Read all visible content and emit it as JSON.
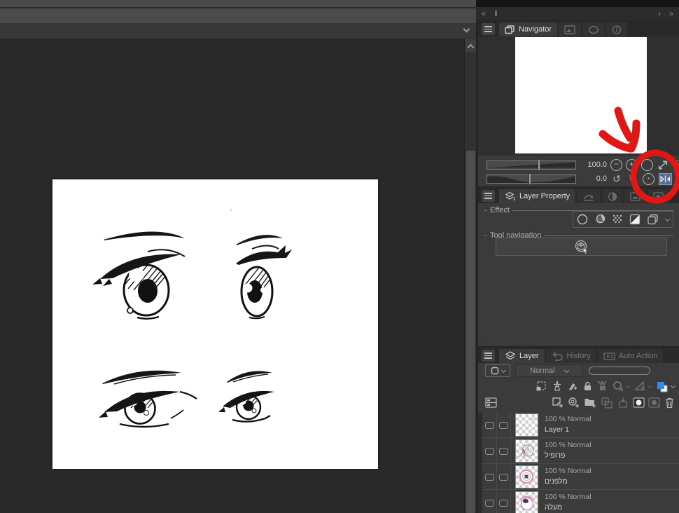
{
  "dock": {
    "collapse_left": "«",
    "divider": "‖",
    "scroll_prev": "›",
    "scroll_next": "»"
  },
  "navigator": {
    "tab_label": "Navigator",
    "zoom_value": "100.0",
    "rotation_value": "0.0",
    "zoom_out_glyph": "−",
    "zoom_in_glyph": "+",
    "rotate_left_glyph": "↺",
    "rotate_right_glyph": "↻",
    "icons": [
      "navigator-icon",
      "subview-icon",
      "quick-share-icon",
      "information-icon",
      "fit-to-screen-icon",
      "fit-to-window-icon",
      "reset-zoom-icon",
      "reset-rotate-icon",
      "flip-horizontal-icon",
      "flip-vertical-icon"
    ]
  },
  "layer_property": {
    "tab_label": "Layer Property",
    "effect_label": "Effect",
    "tool_navigation_label": "Tool navigation",
    "effect_icons": [
      "border-effect-icon",
      "tone-effect-icon",
      "halftone-icon",
      "layer-color-effect-icon",
      "expression-color-icon"
    ]
  },
  "layer_panel": {
    "tab_layer": "Layer",
    "tab_history": "History",
    "tab_auto_action": "Auto Action",
    "blend_mode": "Normal",
    "lock_icons": [
      "clip-at-layer-below-icon",
      "draft-layer-icon",
      "lock-layer-icon",
      "lock-transparent-pixel-icon",
      "enable-mask-icon",
      "reference-layer-icon",
      "ruler-range-icon",
      "layer-color-icon"
    ],
    "command_icons": [
      "new-raster-layer-icon",
      "new-layer-dialog-icon",
      "new-folder-icon",
      "transfer-to-lower-icon",
      "merge-to-lower-icon",
      "create-mask-icon",
      "apply-mask-icon",
      "delete-layer-icon"
    ],
    "layers": [
      {
        "info": "100 % Normal",
        "name": "Layer 1"
      },
      {
        "info": "100 % Normal",
        "name": "פרופיל"
      },
      {
        "info": "100 % Normal",
        "name": "מלפנים"
      },
      {
        "info": "100 % Normal",
        "name": "מעלה"
      }
    ]
  },
  "colors": {
    "flip_button_active_bg": "#5a6d92",
    "layer_color_blue": "#3f87e5",
    "annotation_red": "#e01717",
    "panel_bg": "#3b3b3b"
  },
  "annotation": {
    "arrow": "red-arrow pointing to flip-horizontal button",
    "circle": "red-circle around flip buttons"
  }
}
